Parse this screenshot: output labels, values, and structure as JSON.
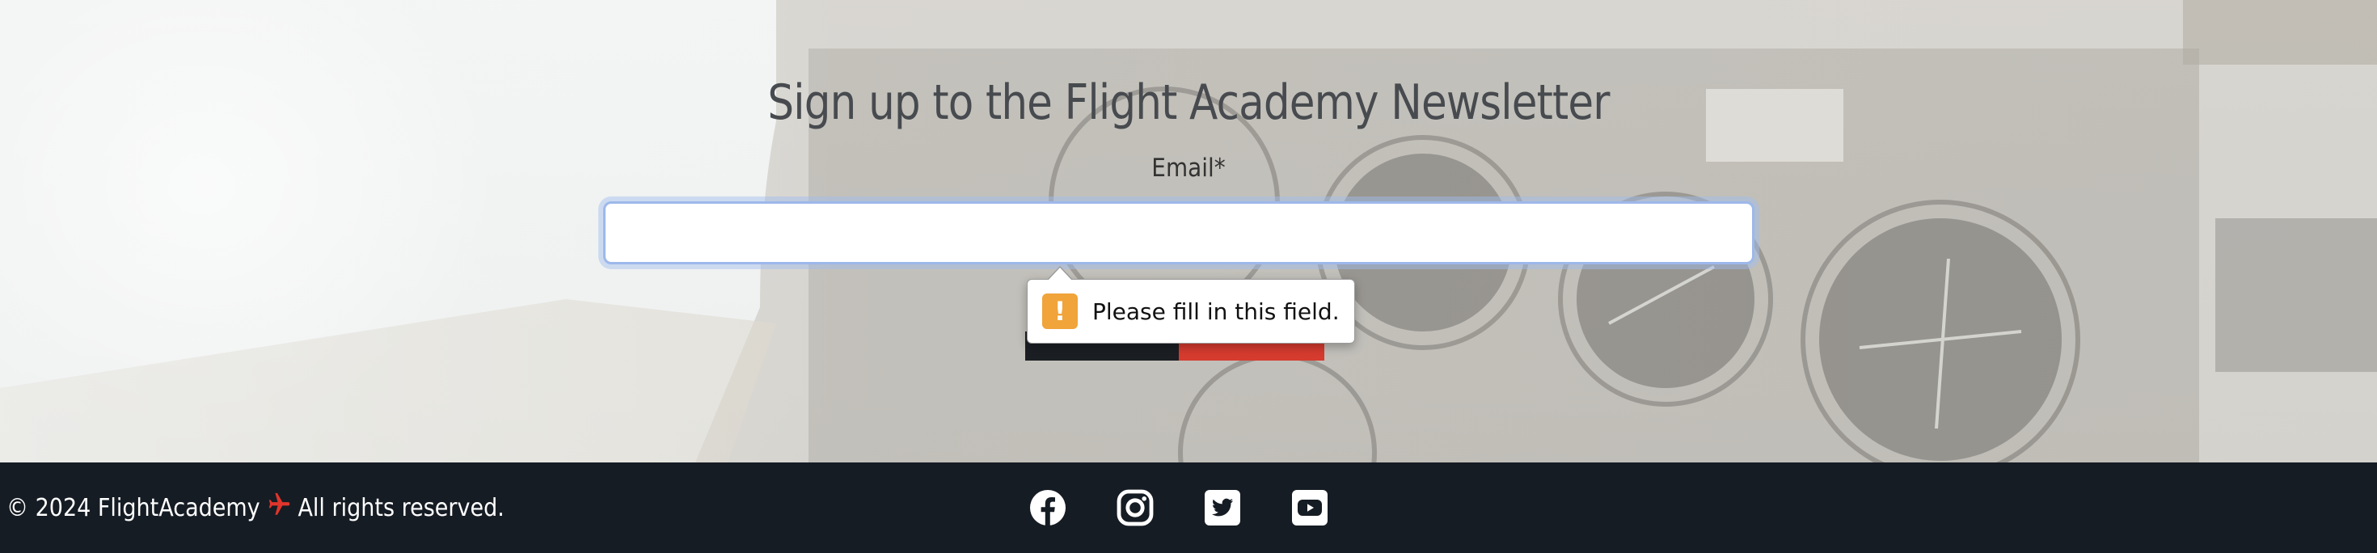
{
  "newsletter": {
    "title": "Sign up to the Flight Academy Newsletter",
    "email_label": "Email*",
    "email_value": "",
    "validation_message": "Please fill in this field.",
    "validation_icon": "warning-icon"
  },
  "footer": {
    "copyright_prefix": "© 2024 FlightAcademy",
    "copyright_suffix": "All rights reserved.",
    "brand_icon": "airplane-icon",
    "social_icons": [
      "facebook-icon",
      "instagram-icon",
      "twitter-icon",
      "youtube-icon"
    ]
  },
  "colors": {
    "footer_background": "#161c24",
    "accent_red": "#d63b2f",
    "warning_orange": "#f0a43a",
    "input_focus": "#9db8ea"
  }
}
